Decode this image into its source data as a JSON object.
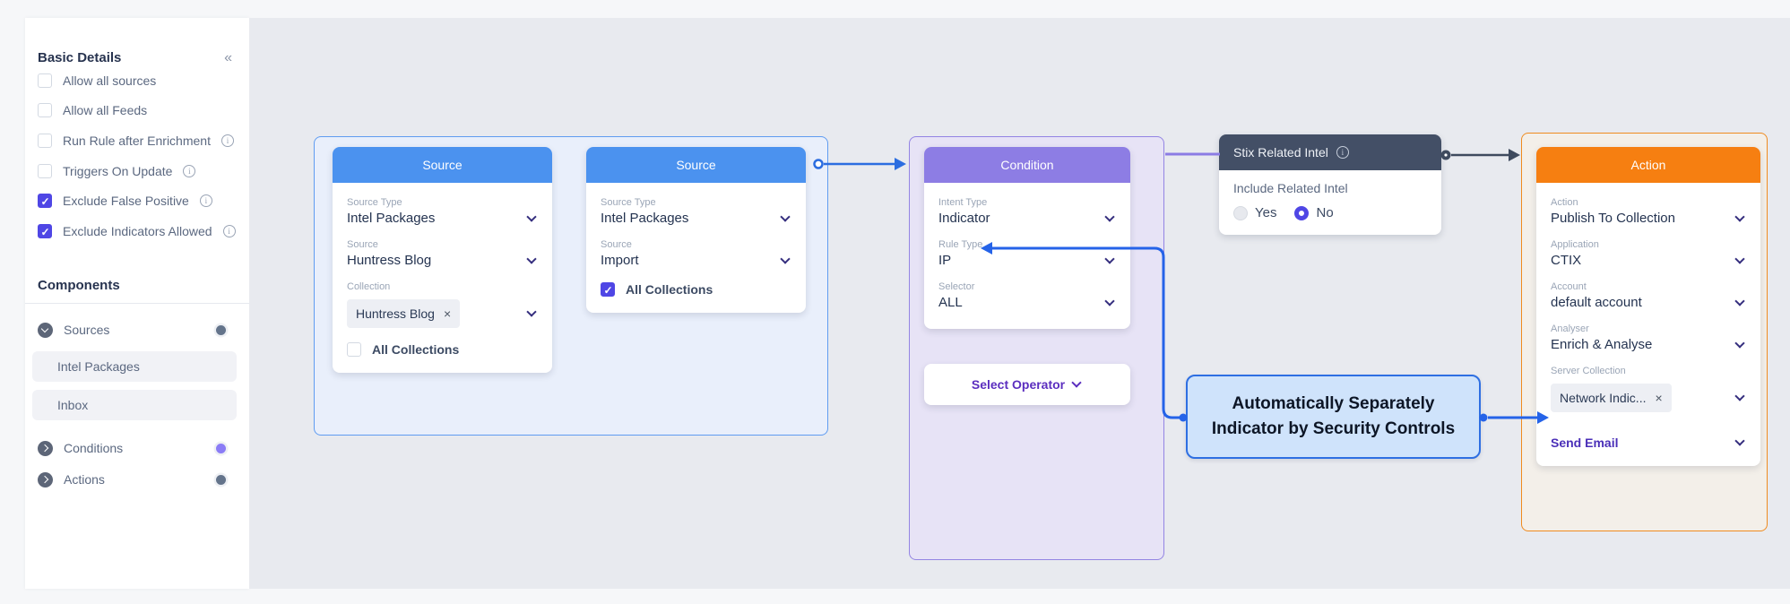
{
  "sidebar": {
    "title": "Basic Details",
    "collapse_icon": "«",
    "checkboxes": [
      {
        "label": "Allow all sources",
        "checked": false,
        "has_info": false
      },
      {
        "label": "Allow all Feeds",
        "checked": false,
        "has_info": false
      },
      {
        "label": "Run Rule after Enrichment",
        "checked": false,
        "has_info": true
      },
      {
        "label": "Triggers On Update",
        "checked": false,
        "has_info": true
      },
      {
        "label": "Exclude False Positive",
        "checked": true,
        "has_info": true
      },
      {
        "label": "Exclude Indicators Allowed",
        "checked": true,
        "has_info": true
      }
    ],
    "components_title": "Components",
    "groups": [
      {
        "label": "Sources",
        "state": "expanded",
        "dot_color": "#64748b"
      },
      {
        "label": "Conditions",
        "state": "collapsed",
        "dot_color": "#8b7cf6"
      },
      {
        "label": "Actions",
        "state": "collapsed",
        "dot_color": "#64748b"
      }
    ],
    "source_items": [
      "Intel Packages",
      "Inbox"
    ]
  },
  "canvas": {
    "source1": {
      "title": "Source",
      "f1_label": "Source Type",
      "f1_value": "Intel Packages",
      "f2_label": "Source",
      "f2_value": "Huntress Blog",
      "f3_label": "Collection",
      "chip": "Huntress Blog",
      "all_collections": "All Collections",
      "all_collections_checked": false
    },
    "source2": {
      "title": "Source",
      "f1_label": "Source Type",
      "f1_value": "Intel Packages",
      "f2_label": "Source",
      "f2_value": "Import",
      "all_collections": "All Collections",
      "all_collections_checked": true
    },
    "condition": {
      "title": "Condition",
      "f1_label": "Intent Type",
      "f1_value": "Indicator",
      "f2_label": "Rule Type",
      "f2_value": "IP",
      "f3_label": "Selector",
      "f3_value": "ALL",
      "select_operator": "Select Operator"
    },
    "stix": {
      "title": "Stix Related Intel",
      "body_label": "Include Related Intel",
      "option_yes": "Yes",
      "option_no": "No",
      "selected": "No"
    },
    "action": {
      "title": "Action",
      "f1_label": "Action",
      "f1_value": "Publish To Collection",
      "f2_label": "Application",
      "f2_value": "CTIX",
      "f3_label": "Account",
      "f3_value": "default account",
      "f4_label": "Analyser",
      "f4_value": "Enrich & Analyse",
      "f5_label": "Server Collection",
      "chip": "Network Indic...",
      "send_email": "Send Email"
    },
    "note": {
      "line1": "Automatically Separately",
      "line2": "Indicator by Security Controls"
    }
  },
  "colors": {
    "source_header": "#4b92ef",
    "condition_header": "#8d7de4",
    "stix_header": "#434f66",
    "action_header": "#f67f11",
    "checked_control": "#4f46e5",
    "connector_blue": "#2563e8",
    "connector_purple": "#8b7ce4",
    "connector_dark": "#3e4a5e",
    "note_bg": "#cfe3fb",
    "note_border": "#2e6fe2",
    "canvas_bg": "#e8eaef"
  }
}
